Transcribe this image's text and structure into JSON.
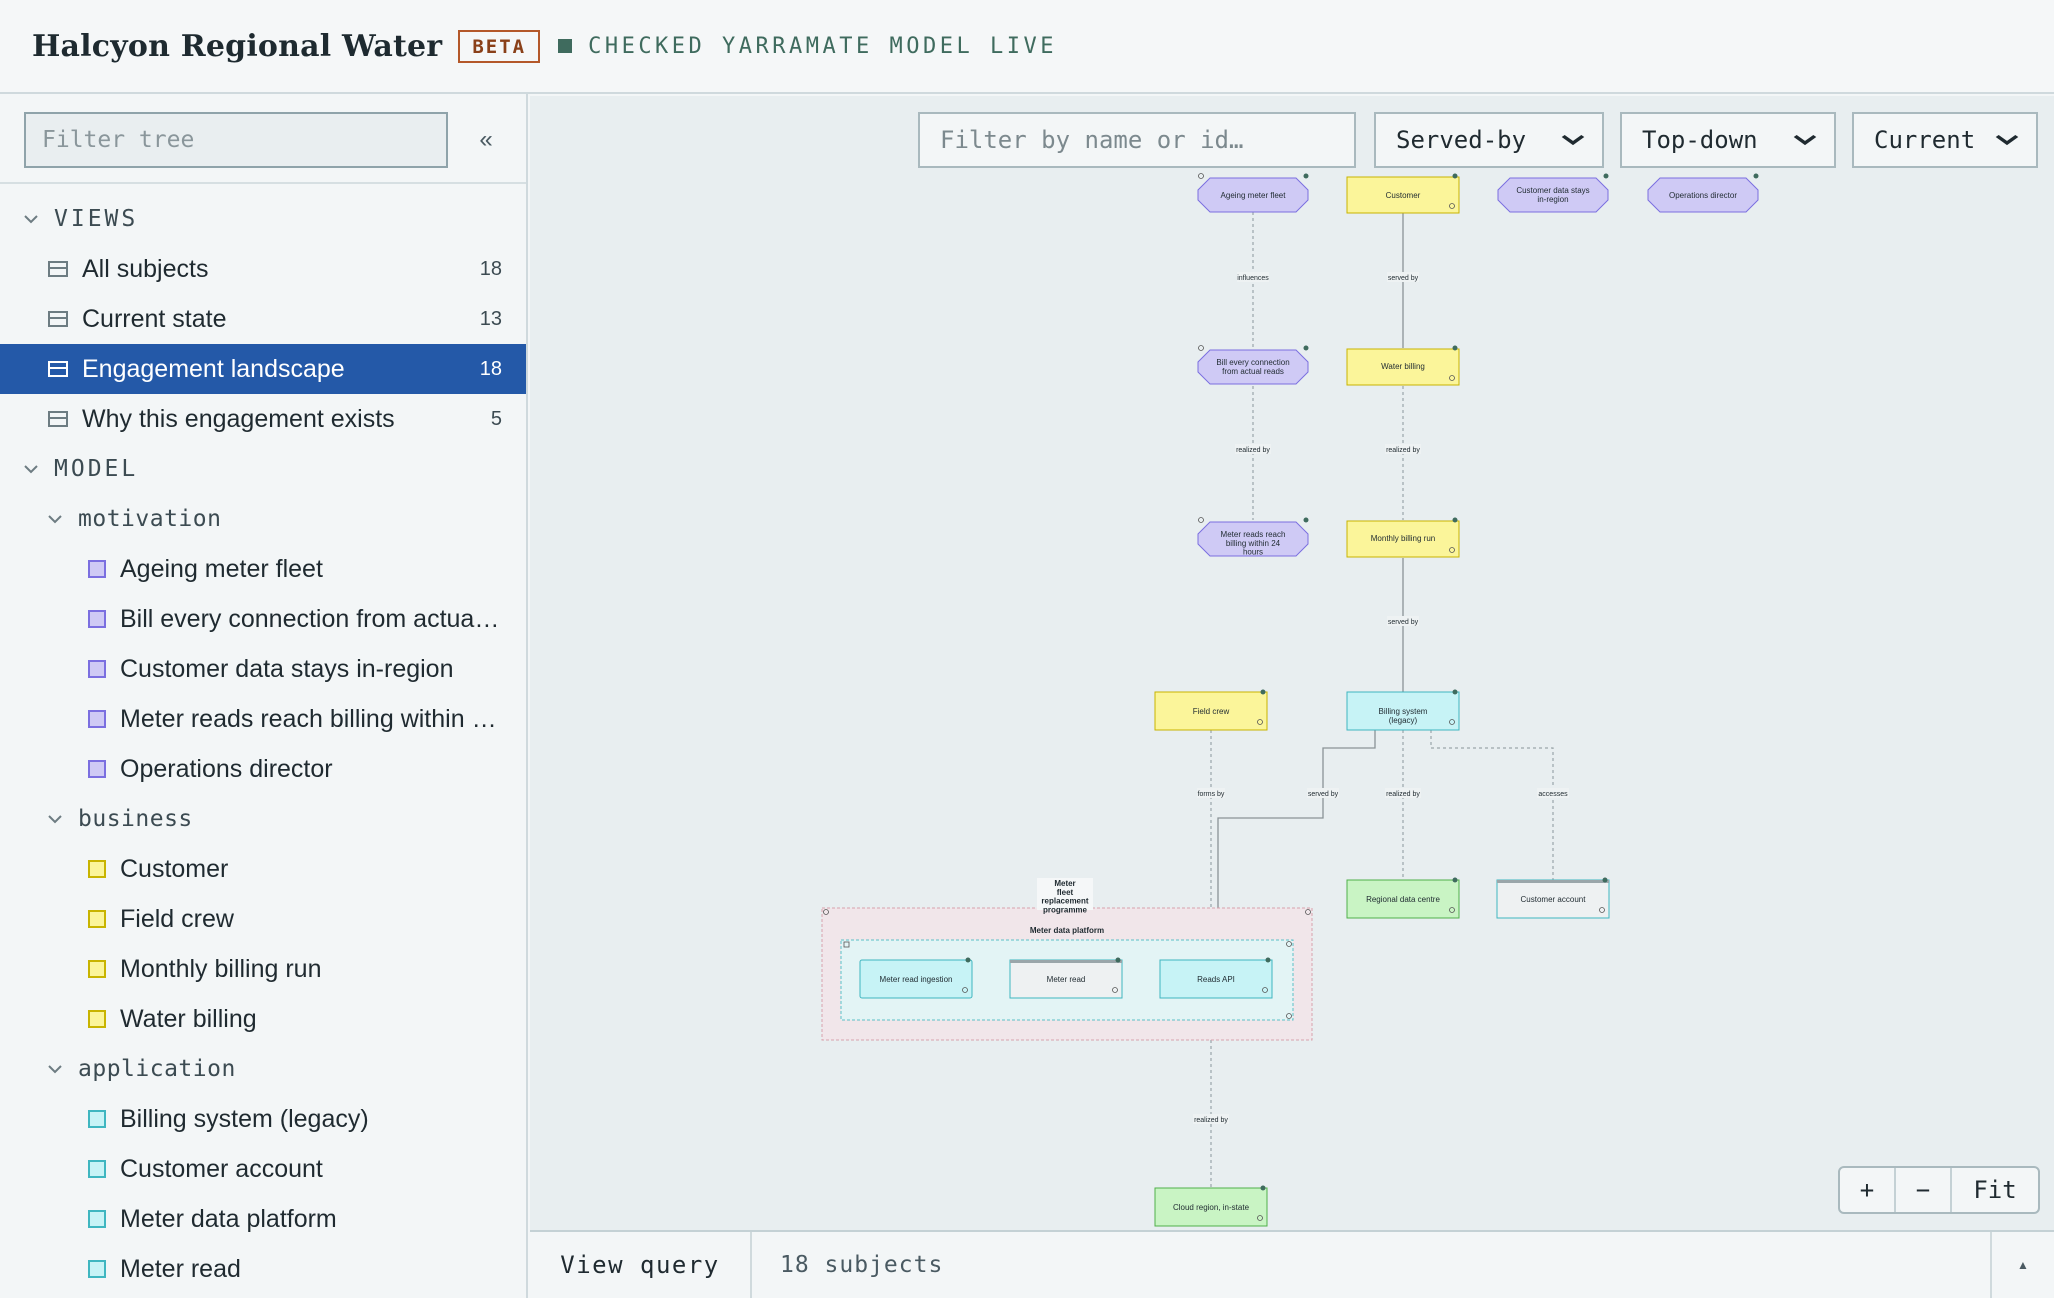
{
  "header": {
    "title": "Halcyon Regional Water",
    "badge": "BETA",
    "status": "CHECKED YARRAMATE MODEL LIVE"
  },
  "sidebar": {
    "filter_placeholder": "Filter tree",
    "collapse_glyph": "«",
    "views_heading": "VIEWS",
    "views": [
      {
        "label": "All subjects",
        "count": "18"
      },
      {
        "label": "Current state",
        "count": "13"
      },
      {
        "label": "Engagement landscape",
        "count": "18"
      },
      {
        "label": "Why this engagement exists",
        "count": "5"
      }
    ],
    "model_heading": "MODEL",
    "groups": [
      {
        "label": "motivation",
        "color": "#7b6fe0",
        "fill": "#cfcaf5",
        "items": [
          "Ageing meter fleet",
          "Bill every connection from actual reads",
          "Customer data stays in-region",
          "Meter reads reach billing within 24 hours",
          "Operations director"
        ]
      },
      {
        "label": "business",
        "color": "#c8b400",
        "fill": "#fbf59a",
        "items": [
          "Customer",
          "Field crew",
          "Monthly billing run",
          "Water billing"
        ]
      },
      {
        "label": "application",
        "color": "#3fb6c0",
        "fill": "#c7f3f6",
        "items": [
          "Billing system (legacy)",
          "Customer account",
          "Meter data platform",
          "Meter read"
        ]
      }
    ]
  },
  "toolbar": {
    "filter_placeholder": "Filter by name or id…",
    "relation": "Served-by",
    "direction": "Top-down",
    "state": "Current"
  },
  "diagram": {
    "nodes": {
      "ageing": "Ageing meter fleet",
      "customer": "Customer",
      "data_region": "Customer data stays in-region",
      "ops": "Operations director",
      "bill_every": "Bill every connection from actual reads",
      "water_billing": "Water billing",
      "meter_reads_24": "Meter reads reach billing within 24 hours",
      "monthly": "Monthly billing run",
      "field_crew": "Field crew",
      "billing_legacy": "Billing system (legacy)",
      "regional_dc": "Regional data centre",
      "cust_account": "Customer account",
      "mdp": "Meter data platform",
      "programme": "Meter fleet replacement programme",
      "ingestion": "Meter read ingestion",
      "meter_read": "Meter read",
      "reads_api": "Reads API",
      "cloud": "Cloud region, in-state"
    },
    "edges": {
      "influences": "influences",
      "served_by": "served by",
      "realized_by": "realized by",
      "forms_by": "forms by",
      "accesses": "accesses"
    }
  },
  "zoom": {
    "in": "+",
    "out": "−",
    "fit": "Fit"
  },
  "bottom": {
    "view_query": "View query",
    "subject_count": "18 subjects",
    "expand_glyph": "▲"
  }
}
